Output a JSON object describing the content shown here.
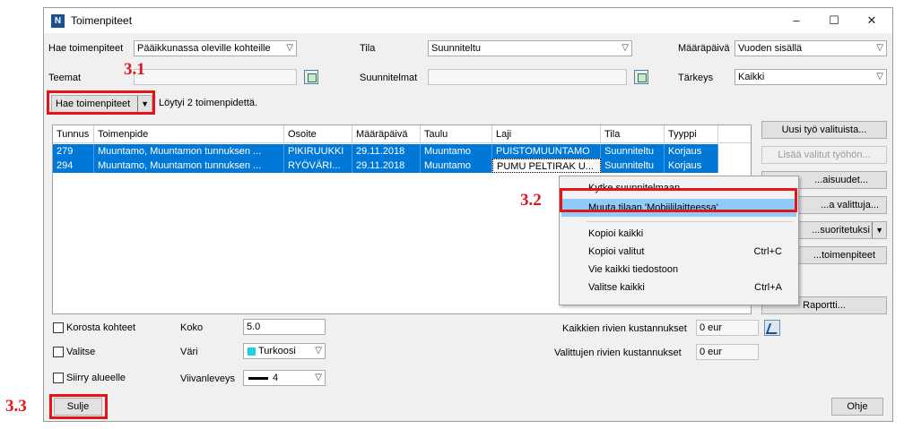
{
  "window": {
    "title": "Toimenpiteet",
    "app_icon_letter": "N",
    "controls": {
      "minimize": "–",
      "maximize": "☐",
      "close": "✕"
    }
  },
  "filters": {
    "hae_label": "Hae toimenpiteet",
    "hae_value": "Pääikkunassa oleville kohteille",
    "tila_label": "Tila",
    "tila_value": "Suunniteltu",
    "maarapaiva_label": "Määräpäivä",
    "maarapaiva_value": "Vuoden sisällä",
    "teemat_label": "Teemat",
    "teemat_value": "",
    "suunnitelmat_label": "Suunnitelmat",
    "suunnitelmat_value": "",
    "tarkeys_label": "Tärkeys",
    "tarkeys_value": "Kaikki"
  },
  "search": {
    "button_label": "Hae toimenpiteet",
    "result_text": "Löytyi 2 toimenpidettä."
  },
  "grid": {
    "columns": [
      "Tunnus",
      "Toimenpide",
      "Osoite",
      "Määräpäivä",
      "Taulu",
      "Laji",
      "Tila",
      "Tyyppi"
    ],
    "rows": [
      [
        "279",
        "Muuntamo, Muuntamon tunnuksen ...",
        "PIKIRUUKKI",
        "29.11.2018",
        "Muuntamo",
        "PUISTOMUUNTAMO",
        "Suunniteltu",
        "Korjaus"
      ],
      [
        "294",
        "Muuntamo, Muuntamon tunnuksen ...",
        "RYÖVÄRI...",
        "29.11.2018",
        "Muuntamo",
        "PUMU PELTIRAK U...",
        "Suunniteltu",
        "Korjaus"
      ]
    ]
  },
  "side_buttons": {
    "uusi": "Uusi työ valituista...",
    "lisaa": "Lisää valitut työhön...",
    "ominaisuudet": "...aisuudet...",
    "valittuja": "...a valittuja...",
    "suoritetuksi": "...suoritetuksi",
    "toimenpiteet": "...toimenpiteet",
    "raportti": "Raportti..."
  },
  "context_menu": {
    "items": [
      {
        "label": "Kytke suunnitelmaan...",
        "shortcut": ""
      },
      {
        "label": "Muuta tilaan 'Mobiililaitteessa'",
        "shortcut": ""
      },
      {
        "label": "Kopioi kaikki",
        "shortcut": ""
      },
      {
        "label": "Kopioi valitut",
        "shortcut": "Ctrl+C"
      },
      {
        "label": "Vie kaikki tiedostoon",
        "shortcut": ""
      },
      {
        "label": "Valitse kaikki",
        "shortcut": "Ctrl+A"
      }
    ]
  },
  "bottom": {
    "korosta_label": "Korosta kohteet",
    "valitse_label": "Valitse",
    "siirry_label": "Siirry alueelle",
    "koko_label": "Koko",
    "koko_value": "5.0",
    "vari_label": "Väri",
    "vari_value": "Turkoosi",
    "vari_color": "#1ad2e2",
    "viivanleveys_label": "Viivanleveys",
    "viivanleveys_value": "4",
    "kaikki_kust_label": "Kaikkien rivien kustannukset",
    "kaikki_kust_value": "0 eur",
    "valitut_kust_label": "Valittujen rivien kustannukset",
    "valitut_kust_value": "0 eur",
    "sulje_label": "Sulje",
    "ohje_label": "Ohje"
  },
  "annotations": {
    "label_1": "3.1",
    "label_2": "3.2",
    "label_3": "3.3",
    "color": "#e4141b"
  },
  "colors": {
    "selection": "#0078d7",
    "menu_highlight": "#91c9f7"
  }
}
